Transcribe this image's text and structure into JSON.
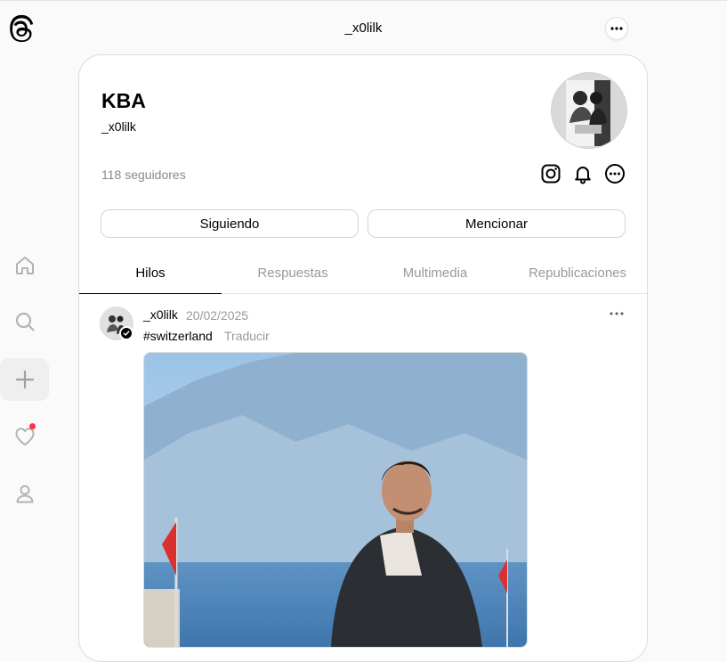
{
  "header": {
    "username": "_x0lilk"
  },
  "nav": {
    "items": [
      {
        "icon": "home-icon"
      },
      {
        "icon": "search-icon"
      },
      {
        "icon": "plus-icon"
      },
      {
        "icon": "heart-icon",
        "has_notification": true
      },
      {
        "icon": "person-icon"
      }
    ]
  },
  "profile": {
    "name": "KBA",
    "handle": "_x0lilk",
    "followers": "118 seguidores",
    "buttons": {
      "following": "Siguiendo",
      "mention": "Mencionar"
    },
    "icons": [
      "instagram-icon",
      "bell-icon",
      "more-icon"
    ]
  },
  "tabs": [
    {
      "label": "Hilos",
      "active": true
    },
    {
      "label": "Respuestas",
      "active": false
    },
    {
      "label": "Multimedia",
      "active": false
    },
    {
      "label": "Republicaciones",
      "active": false
    }
  ],
  "post": {
    "username": "_x0lilk",
    "date": "20/02/2025",
    "text": "#switzerland",
    "translate": "Traducir"
  },
  "colors": {
    "notification_dot": "#ff3040",
    "text_muted": "#999999",
    "border": "#dcdcdc"
  }
}
